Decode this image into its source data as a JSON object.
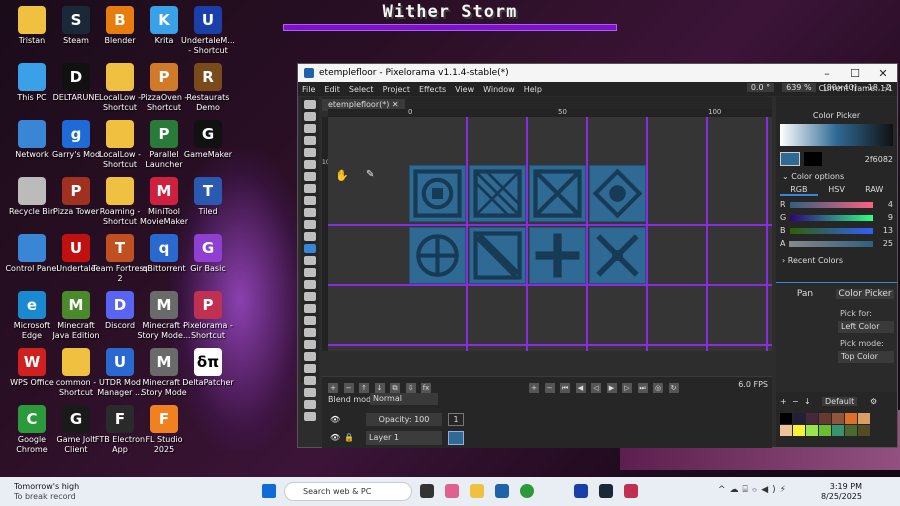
{
  "game_overlay": {
    "boss_name": "Wither Storm"
  },
  "desktop_icons": [
    {
      "label": "Tristan",
      "glyph": "",
      "color": "#f0c040"
    },
    {
      "label": "Steam",
      "glyph": "S",
      "color": "#1b2838"
    },
    {
      "label": "Blender",
      "glyph": "B",
      "color": "#e87d0d"
    },
    {
      "label": "Krita",
      "glyph": "K",
      "color": "#3aa0e8"
    },
    {
      "label": "UndertaleM... - Shortcut",
      "glyph": "U",
      "color": "#1b3fa8"
    },
    {
      "label": "This PC",
      "glyph": "",
      "color": "#3aa0e8"
    },
    {
      "label": "DELTARUNE",
      "glyph": "D",
      "color": "#111111"
    },
    {
      "label": "LocalLow - Shortcut",
      "glyph": "",
      "color": "#f0c040"
    },
    {
      "label": "PizzaOven - Shortcut",
      "glyph": "P",
      "color": "#d07a2a"
    },
    {
      "label": "Restaurats Demo",
      "glyph": "R",
      "color": "#7a4a1a"
    },
    {
      "label": "Network",
      "glyph": "",
      "color": "#3a86d6"
    },
    {
      "label": "Garry's Mod",
      "glyph": "g",
      "color": "#1e6ad6"
    },
    {
      "label": "LocalLow - Shortcut",
      "glyph": "",
      "color": "#f0c040"
    },
    {
      "label": "Parallel Launcher",
      "glyph": "P",
      "color": "#2a7a3a"
    },
    {
      "label": "GameMaker",
      "glyph": "G",
      "color": "#111111"
    },
    {
      "label": "Recycle Bin",
      "glyph": "",
      "color": "#bbbbbb"
    },
    {
      "label": "Pizza Tower",
      "glyph": "P",
      "color": "#a03020"
    },
    {
      "label": "Roaming - Shortcut",
      "glyph": "",
      "color": "#f0c040"
    },
    {
      "label": "MiniTool MovieMaker",
      "glyph": "M",
      "color": "#d02040"
    },
    {
      "label": "Tiled",
      "glyph": "T",
      "color": "#2a5ab0"
    },
    {
      "label": "Control Panel",
      "glyph": "",
      "color": "#3a86d6"
    },
    {
      "label": "Undertale",
      "glyph": "U",
      "color": "#c01010"
    },
    {
      "label": "Team Fortress 2",
      "glyph": "T",
      "color": "#c05020"
    },
    {
      "label": "qBittorrent",
      "glyph": "q",
      "color": "#2a6ad0"
    },
    {
      "label": "Gir Basic",
      "glyph": "G",
      "color": "#9040d0"
    },
    {
      "label": "Microsoft Edge",
      "glyph": "e",
      "color": "#1a8ad0"
    },
    {
      "label": "Minecraft Java Edition",
      "glyph": "M",
      "color": "#4a8a2a"
    },
    {
      "label": "Discord",
      "glyph": "D",
      "color": "#5865f2"
    },
    {
      "label": "Minecraft - Story Mode...",
      "glyph": "M",
      "color": "#6a6a6a"
    },
    {
      "label": "Pixelorama - Shortcut",
      "glyph": "P",
      "color": "#c03050"
    },
    {
      "label": "WPS Office",
      "glyph": "W",
      "color": "#d02020"
    },
    {
      "label": "common - Shortcut",
      "glyph": "",
      "color": "#f0c040"
    },
    {
      "label": "UTDR Mod Manager ...",
      "glyph": "U",
      "color": "#2a6ad0"
    },
    {
      "label": "Minecraft - Story Mode",
      "glyph": "M",
      "color": "#6a6a6a"
    },
    {
      "label": "DeltaPatcher",
      "glyph": "δπ",
      "color": "#ffffff"
    },
    {
      "label": "Google Chrome",
      "glyph": "C",
      "color": "#2a9a3a"
    },
    {
      "label": "Game Jolt Client",
      "glyph": "G",
      "color": "#1a1a1a"
    },
    {
      "label": "FTB Electron App",
      "glyph": "F",
      "color": "#2a2a2a"
    },
    {
      "label": "FL Studio 2025",
      "glyph": "F",
      "color": "#f08020"
    }
  ],
  "window": {
    "title": "etemplefloor - Pixelorama v1.1.4-stable(*)",
    "minimize": "–",
    "maximize": "☐",
    "close": "✕",
    "menu": [
      "File",
      "Edit",
      "Select",
      "Project",
      "Effects",
      "View",
      "Window",
      "Help"
    ],
    "rotation": "0.0 °",
    "zoom": "639 %",
    "canvas_size": "[80×40]",
    "cursor_pos": "-18, -2",
    "current_frame": "Current frame: 1/1",
    "tab_label": "etemplefloor(*)",
    "ruler_marks": [
      "0",
      "50",
      "100"
    ],
    "ruler_v_mark": "10"
  },
  "timeline": {
    "blend_label": "Blend mode:",
    "blend_value": "Normal",
    "opacity": "Opacity: 100",
    "frame_number": "1",
    "layer_name": "Layer 1",
    "fps": "6.0 FPS"
  },
  "color_panel": {
    "title": "Color Picker",
    "hex": "2f6082",
    "options_label": "Color options",
    "modes": [
      "RGB",
      "HSV",
      "RAW"
    ],
    "sliders": [
      {
        "label": "R",
        "value": "4",
        "gradient": "linear-gradient(90deg,#2f6082,#ff6082)"
      },
      {
        "label": "G",
        "value": "9",
        "gradient": "linear-gradient(90deg,#2f0082,#2fff82)"
      },
      {
        "label": "B",
        "value": "13",
        "gradient": "linear-gradient(90deg,#2f6000,#2f60ff)"
      },
      {
        "label": "A",
        "value": "25",
        "gradient": "linear-gradient(90deg,#888,#2f6082)"
      }
    ],
    "recent_label": "Recent Colors"
  },
  "mouse_panel": {
    "left_tool": "Pan",
    "right_tool": "Color Picker",
    "pick_for_label": "Pick for:",
    "pick_for_value": "Left Color",
    "pick_mode_label": "Pick mode:",
    "pick_mode_value": "Top Color"
  },
  "palette": {
    "name": "Default",
    "colors": [
      "#000000",
      "#222034",
      "#45283c",
      "#663931",
      "#8f563b",
      "#df7126",
      "#d9a066",
      "#eec39a",
      "#fbf236",
      "#99e550",
      "#6abe30",
      "#37946e",
      "#4b692f",
      "#524b24"
    ]
  },
  "taskbar": {
    "weather_title": "Tomorrow's high",
    "weather_sub": "To break record",
    "search_placeholder": "Search web & PC",
    "time": "3:19 PM",
    "date": "8/25/2025"
  }
}
